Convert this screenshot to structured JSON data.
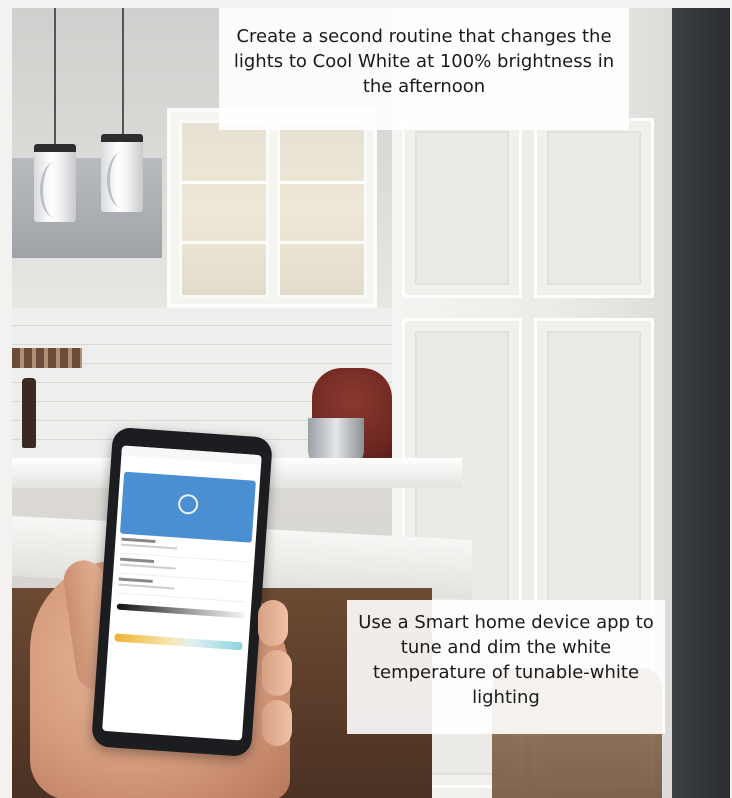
{
  "captions": {
    "top": "Create a second routine that changes the lights to Cool White at 100% brightness in the afternoon",
    "bottom": "Use a Smart home device app to tune and dim the white temperature of tunable-white lighting"
  },
  "colors": {
    "phone_hero": "#4b8fd3",
    "warm_white": "#f2b233",
    "cool_white": "#8dd3de"
  }
}
